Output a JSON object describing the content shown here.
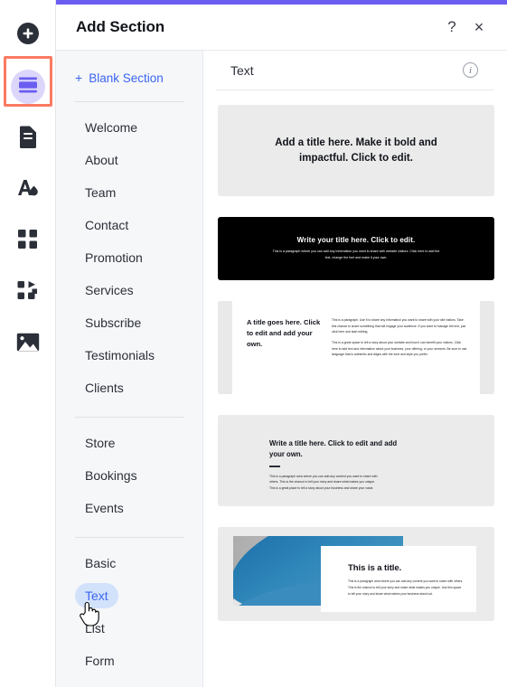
{
  "window": {
    "title": "Add Section",
    "help_label": "?",
    "close_label": "×",
    "accent_color": "#6a5df0"
  },
  "rail": {
    "items": [
      {
        "name": "add-icon",
        "label": "Add"
      },
      {
        "name": "section-icon",
        "label": "Section"
      },
      {
        "name": "page-icon",
        "label": "Page"
      },
      {
        "name": "text-theme-icon",
        "label": "Text & Theme"
      },
      {
        "name": "apps-grid-icon",
        "label": "Apps"
      },
      {
        "name": "add-apps-icon",
        "label": "Add Apps"
      },
      {
        "name": "media-icon",
        "label": "Media"
      }
    ],
    "selected_index": 1,
    "highlight_color": "#fa7a62",
    "selected_bubble_color": "#ddd6fb",
    "selected_glyph_color": "#6a5df0"
  },
  "menu": {
    "blank_section": {
      "plus": "+",
      "label": "Blank Section"
    },
    "groups": [
      {
        "items": [
          "Welcome",
          "About",
          "Team",
          "Contact",
          "Promotion",
          "Services",
          "Subscribe",
          "Testimonials",
          "Clients"
        ]
      },
      {
        "items": [
          "Store",
          "Bookings",
          "Events"
        ]
      },
      {
        "items": [
          "Basic",
          "Text",
          "List",
          "Form"
        ]
      }
    ],
    "active_item": "Text",
    "link_color": "#3c65f0",
    "active_pill_color": "#d2e2fb"
  },
  "content": {
    "title": "Text",
    "info_icon_label": "i",
    "cards": [
      {
        "name": "text-card-centered-title",
        "title": "Add a title here. Make it bold and impactful. Click to edit."
      },
      {
        "name": "text-card-dark-title-paragraph",
        "title": "Write your title here. Click to edit.",
        "paragraph": "This is a paragraph where you can add any information you want to share with website visitors. Click here to add the text, change the font and make it your own."
      },
      {
        "name": "text-card-two-column",
        "title": "A title goes here. Click to edit and add your own.",
        "paragraphs": [
          "This is a paragraph. Use it to share any information you want to share with your site visitors. Take this chance to share something that will engage your audience. If you want to manage the text, just click here and start editing.",
          "This is a great space to tell a story about your website and how it can benefit your visitors. Click here to add text and information about your business, your offering, or your services. Be sure to use language that is authentic and aligns with the tone and style you prefer."
        ]
      },
      {
        "name": "text-card-title-divider-paragraph",
        "title": "Write a title here. Click to edit and add your own.",
        "paragraph": "This is a paragraph area where you can add any content you want to share with others. This is the chance to tell your story and share what makes you unique. This is a great place to tell a story about your business and share your value."
      },
      {
        "name": "text-card-image-overlay",
        "title": "This is a title.",
        "paragraph": "This is a paragraph area where you can add any content you want to share with others. This is the chance to tell your story and share what makes you unique. Use this space to tell your story and share what makes your business stand out."
      }
    ]
  }
}
